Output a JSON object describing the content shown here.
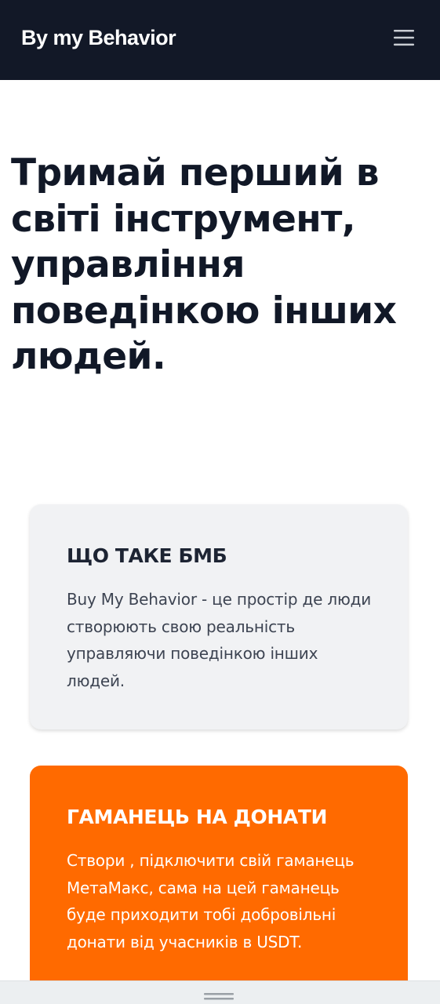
{
  "header": {
    "brand": "By my Behavior",
    "menu_icon": "hamburger-menu-icon",
    "background": "#121827"
  },
  "hero": {
    "title": "Тримай перший в світі інструмент, управління поведінкою інших людей."
  },
  "cards": [
    {
      "title": "ЩО ТАКЕ БМБ",
      "text": "Buy My Behavior - це простір де люди створюють свою реальність управляючи поведінкою інших людей.",
      "background": "#f1f2f4"
    },
    {
      "title": "ГАМАНЕЦЬ НА ДОНАТИ",
      "text": "Створи , підключити свій гаманець МетаМакс, сама на цей гаманець буде приходити тобі добровільні донати від учасників в USDT.",
      "background": "#ff6a00"
    }
  ],
  "bottom_bar": {
    "handle_icon": "drag-handle-icon"
  },
  "colors": {
    "accent": "#ff6a00",
    "text_dark": "#111827"
  }
}
